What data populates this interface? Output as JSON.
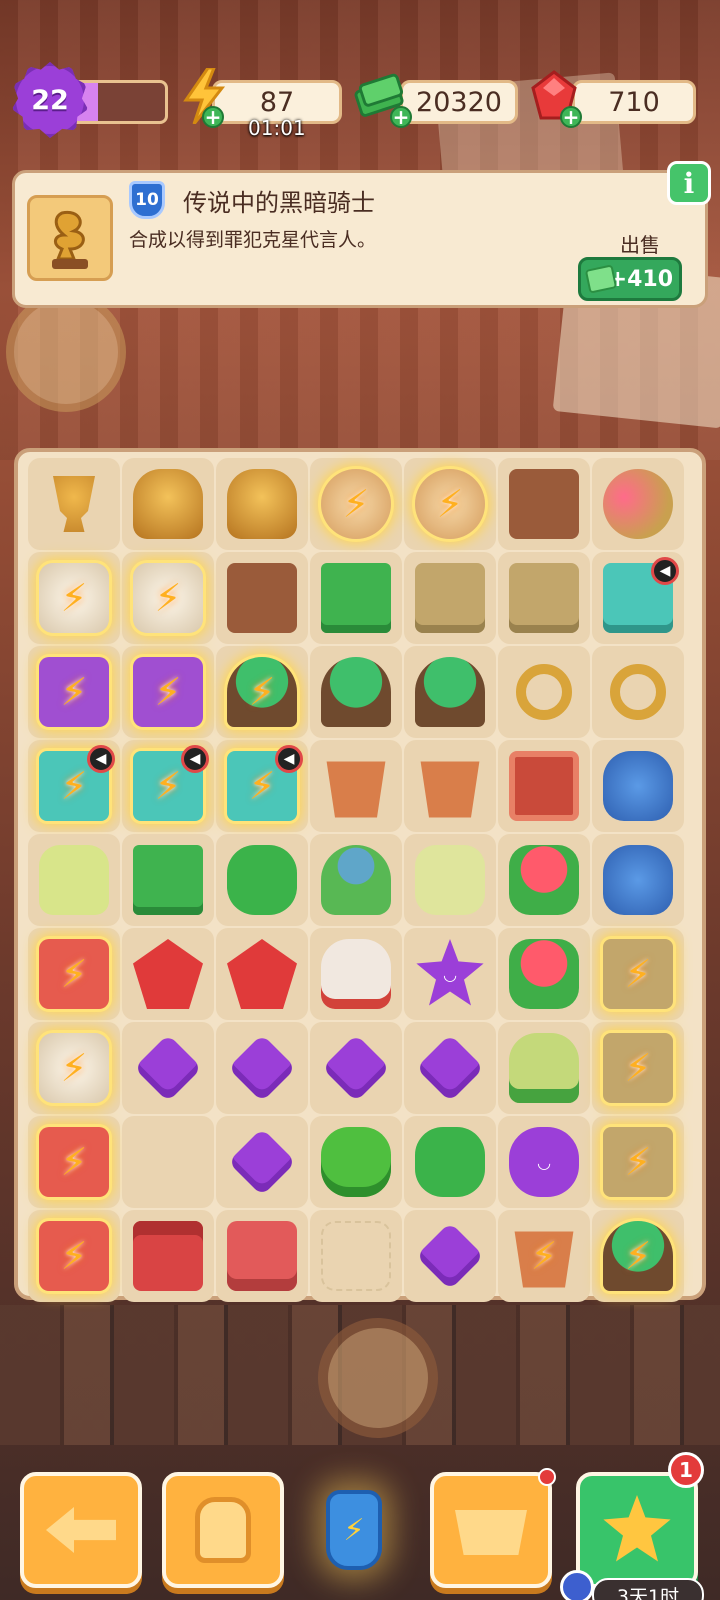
{
  "topbar": {
    "level": "22",
    "xp_progress": 0.32,
    "energy": {
      "value": "87",
      "timer": "01:01",
      "icon": "lightning-icon",
      "plus": "+"
    },
    "cash": {
      "value": "20320",
      "icon": "cash-stack-icon",
      "plus": "+"
    },
    "gems": {
      "value": "710",
      "icon": "ruby-icon",
      "plus": "+"
    }
  },
  "info": {
    "item_icon": "golden-dragon-trophy-icon",
    "level": "10",
    "title": "传说中的黑暗骑士",
    "description": "合成以得到罪犯克星代言人。",
    "info_button": "i",
    "sell_label": "出售",
    "sell_value": "+410"
  },
  "board": {
    "rows": [
      [
        {
          "t": "trophy"
        },
        {
          "t": "gold"
        },
        {
          "t": "gold"
        },
        {
          "t": "frame",
          "g": 1
        },
        {
          "t": "frame",
          "g": 1
        },
        {
          "t": "brown"
        },
        {
          "t": "flowers"
        }
      ],
      [
        {
          "t": "white",
          "g": 1
        },
        {
          "t": "white",
          "g": 1
        },
        {
          "t": "brown"
        },
        {
          "t": "cash"
        },
        {
          "t": "tan"
        },
        {
          "t": "tan"
        },
        {
          "t": "teal",
          "s": 1
        }
      ],
      [
        {
          "t": "purple",
          "g": 1
        },
        {
          "t": "purple",
          "g": 1
        },
        {
          "t": "tree",
          "g": 1
        },
        {
          "t": "tree"
        },
        {
          "t": "tree"
        },
        {
          "t": "ring"
        },
        {
          "t": "ring"
        }
      ],
      [
        {
          "t": "teal",
          "g": 1,
          "s": 1
        },
        {
          "t": "teal",
          "g": 1,
          "s": 1
        },
        {
          "t": "teal",
          "g": 1,
          "s": 1
        },
        {
          "t": "pot"
        },
        {
          "t": "pot"
        },
        {
          "t": "tv"
        },
        {
          "t": "vase"
        }
      ],
      [
        {
          "t": "bottle"
        },
        {
          "t": "cash"
        },
        {
          "t": "green"
        },
        {
          "t": "hat"
        },
        {
          "t": "soap"
        },
        {
          "t": "bouquet"
        },
        {
          "t": "vase"
        }
      ],
      [
        {
          "t": "redbox",
          "g": 1
        },
        {
          "t": "ruby"
        },
        {
          "t": "ruby"
        },
        {
          "t": "glove"
        },
        {
          "t": "star"
        },
        {
          "t": "bouquet"
        },
        {
          "t": "tan",
          "g": 1
        }
      ],
      [
        {
          "t": "white",
          "g": 1
        },
        {
          "t": "gem"
        },
        {
          "t": "gem"
        },
        {
          "t": "gem"
        },
        {
          "t": "gem"
        },
        {
          "t": "cake"
        },
        {
          "t": "tan",
          "g": 1
        }
      ],
      [
        {
          "t": "redbox",
          "g": 1
        },
        {
          "t": "empty"
        },
        {
          "t": "gem"
        },
        {
          "t": "sponge"
        },
        {
          "t": "green"
        },
        {
          "t": "blob"
        },
        {
          "t": "tan",
          "g": 1
        }
      ],
      [
        {
          "t": "redbox",
          "g": 1
        },
        {
          "t": "toolbox"
        },
        {
          "t": "basket"
        },
        {
          "t": "ghost"
        },
        {
          "t": "gem"
        },
        {
          "t": "pot",
          "g": 1
        },
        {
          "t": "tree",
          "g": 1
        }
      ]
    ]
  },
  "bottom": {
    "back_icon": "back-arrow-icon",
    "backpack_icon": "backpack-icon",
    "energy_potion_icon": "energy-potion-icon",
    "shop_icon": "shopping-basket-icon",
    "event_icon": "star-event-icon",
    "event_badge": "1",
    "event_timer": "3天1时"
  },
  "colors": {
    "accent_orange": "#ffb23f",
    "accent_green": "#38c46a",
    "purple": "#9b3fd8"
  }
}
